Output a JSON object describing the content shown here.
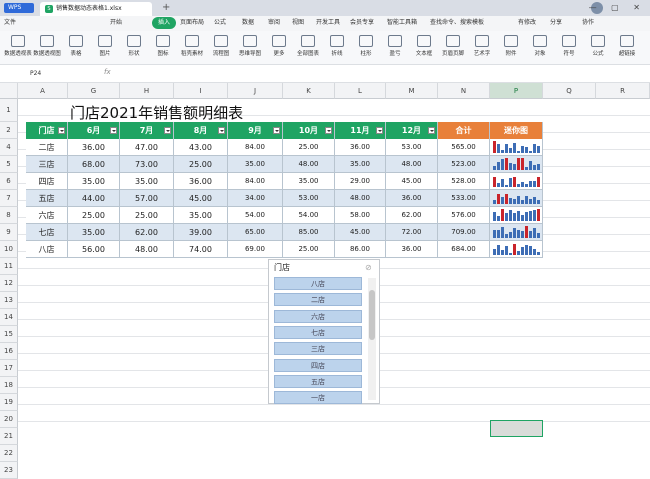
{
  "app": {
    "name": "WPS",
    "file_tab": "销售数据动态表格1.xlsx"
  },
  "menus": [
    "文件",
    "开始",
    "插入",
    "页面布局",
    "公式",
    "数据",
    "审阅",
    "视图",
    "开发工具",
    "会员专享",
    "智能工具箱",
    "查找命令、搜索模板",
    "有修改",
    "分享",
    "协作"
  ],
  "menus_active": "插入",
  "ribbon": [
    "数据透视表",
    "数据透视图",
    "表格",
    "图片",
    "形状",
    "图标",
    "稻壳素材",
    "流程图",
    "思维导图",
    "更多",
    "全部图表",
    "折线",
    "柱形",
    "盈亏",
    "文本框",
    "页眉页脚",
    "艺术字",
    "附件",
    "对象",
    "符号",
    "公式",
    "超链接"
  ],
  "namebox": "P24",
  "fx_label": "fx",
  "col_headers": [
    "A",
    "G",
    "H",
    "I",
    "J",
    "K",
    "L",
    "M",
    "N",
    "P",
    "Q",
    "R"
  ],
  "row_headers": [
    "1",
    "2",
    "4",
    "5",
    "6",
    "7",
    "8",
    "9",
    "10",
    "11",
    "12",
    "13",
    "14",
    "15",
    "16",
    "17",
    "18",
    "19",
    "20",
    "21",
    "22",
    "23"
  ],
  "sheet_title": "门店2021年销售额明细表",
  "table_headers": [
    "门店",
    "6月",
    "7月",
    "8月",
    "9月",
    "10月",
    "11月",
    "12月",
    "合计",
    "迷你图"
  ],
  "rows": [
    [
      "二店",
      "36.00",
      "47.00",
      "43.00",
      "84.00",
      "25.00",
      "36.00",
      "53.00",
      "565.00"
    ],
    [
      "三店",
      "68.00",
      "73.00",
      "25.00",
      "35.00",
      "48.00",
      "35.00",
      "48.00",
      "523.00"
    ],
    [
      "四店",
      "35.00",
      "35.00",
      "36.00",
      "84.00",
      "35.00",
      "29.00",
      "45.00",
      "528.00"
    ],
    [
      "五店",
      "44.00",
      "57.00",
      "45.00",
      "34.00",
      "53.00",
      "48.00",
      "36.00",
      "533.00"
    ],
    [
      "六店",
      "25.00",
      "25.00",
      "35.00",
      "54.00",
      "54.00",
      "58.00",
      "62.00",
      "576.00"
    ],
    [
      "七店",
      "35.00",
      "62.00",
      "39.00",
      "65.00",
      "85.00",
      "45.00",
      "72.00",
      "709.00"
    ],
    [
      "八店",
      "56.00",
      "48.00",
      "74.00",
      "69.00",
      "25.00",
      "86.00",
      "36.00",
      "684.00"
    ]
  ],
  "sparklines": [
    [
      12,
      9,
      3,
      9,
      5,
      10,
      2,
      7,
      6,
      2,
      9,
      7
    ],
    [
      4,
      8,
      11,
      12,
      7,
      6,
      12,
      12,
      3,
      9,
      5,
      6
    ],
    [
      10,
      4,
      8,
      2,
      9,
      10,
      3,
      5,
      3,
      6,
      6,
      10
    ],
    [
      4,
      10,
      7,
      10,
      6,
      5,
      8,
      4,
      8,
      5,
      7,
      4
    ],
    [
      9,
      5,
      12,
      8,
      11,
      8,
      10,
      6,
      9,
      10,
      11,
      12
    ],
    [
      8,
      8,
      11,
      4,
      6,
      10,
      8,
      7,
      12,
      7,
      10,
      5
    ],
    [
      6,
      10,
      5,
      9,
      2,
      11,
      4,
      8,
      10,
      9,
      6,
      3
    ]
  ],
  "colors": {
    "green": "#1fa463",
    "orange": "#e8803a",
    "row_alt": "#dce6f1",
    "spark_bar": "#3d6db5",
    "spark_red": "#c9242b"
  },
  "slicer": {
    "title": "门店",
    "items": [
      "八店",
      "二店",
      "六店",
      "七店",
      "三店",
      "四店",
      "五店",
      "一店"
    ]
  }
}
